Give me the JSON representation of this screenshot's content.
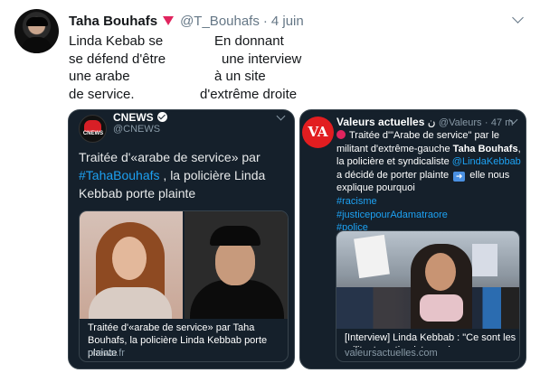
{
  "tweet": {
    "display_name": "Taha Bouhafs",
    "handle": "@T_Bouhafs",
    "separator": "·",
    "date": "4 juin",
    "text_left": [
      "Linda Kebab se",
      "se défend d'être",
      "une arabe",
      "de service."
    ],
    "text_right": [
      "En donnant",
      "une interview",
      "à un site",
      "d'extrême droite"
    ]
  },
  "quote_left": {
    "logo_text": "CNEWS",
    "name": "CNEWS",
    "handle": "@CNEWS",
    "text_before": "Traitée d'«arabe de service» par ",
    "text_link": "#TahaBouhafs",
    "text_after": " , la policière Linda Kebbab porte plainte",
    "card_caption": "Traitée d'«arabe de service» par Taha Bouhafs, la policière Linda Kebbab porte plainte",
    "card_domain": "cnews.fr"
  },
  "quote_right": {
    "logo_text": "VA",
    "name": "Valeurs actuelles",
    "name_suffix": "ن",
    "handle": "@Valeurs",
    "separator": "·",
    "time": "47 m",
    "line1": "Traitée d'\"Arabe de service\" par le",
    "line2_before": "militant d'extrême-gauche ",
    "line2_bold": "Taha Bouhafs",
    "line2_after": ",",
    "line3_before": "la policière et syndicaliste ",
    "line3_link": "@LindaKebbab",
    "line4_before": "a décidé de porter plainte ",
    "line4_after": " elle nous",
    "line5": "explique pourquoi",
    "hashtags": [
      "#racisme",
      "#justicepourAdamatraore",
      "#police"
    ],
    "card_caption": "[Interview] Linda Kebbab : \"Ce sont les militants antiracistes qui me renvoient...",
    "card_domain": "valeursactuelles.com"
  },
  "colors": {
    "accent": "#1da1f2",
    "dark_card": "#15202b",
    "va_red": "#e21d20",
    "cnews_red": "#d81f26"
  },
  "icons": {
    "caret": "chevron-down-icon",
    "flag": "pink-triangle-icon",
    "verified": "verified-check-icon"
  }
}
